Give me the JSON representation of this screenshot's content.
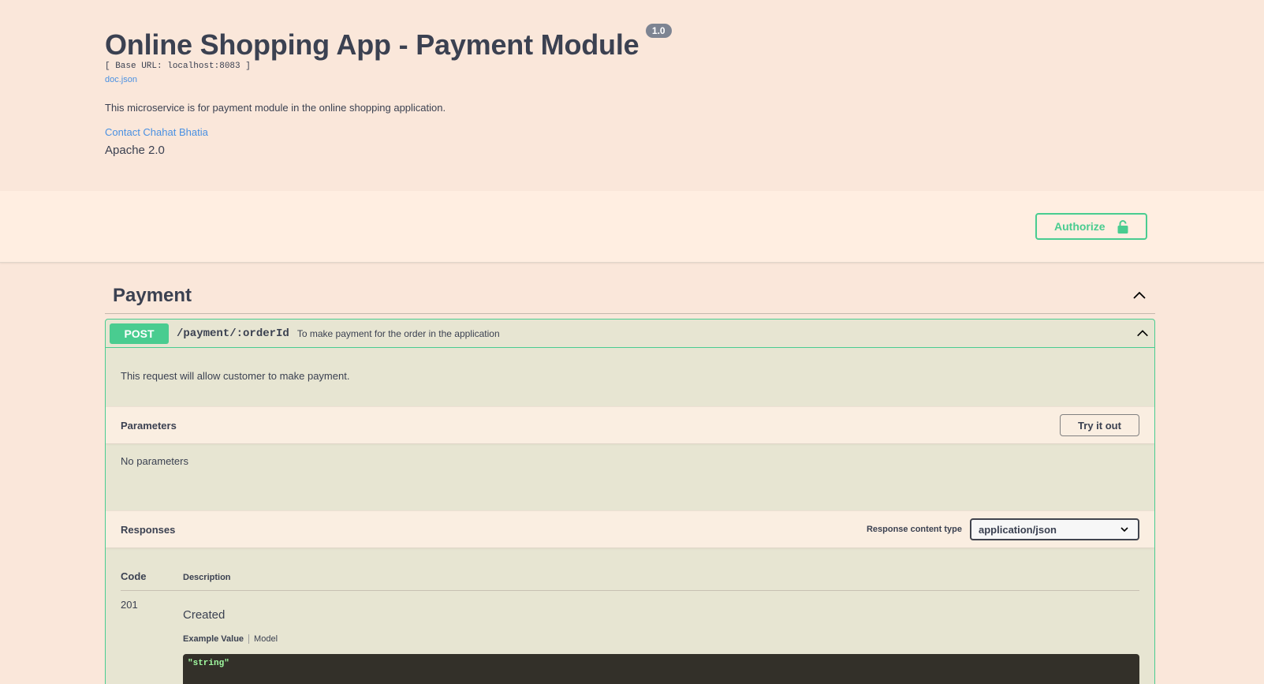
{
  "info": {
    "title": "Online Shopping App - Payment Module",
    "version": "1.0",
    "base_url": "[ Base URL: localhost:8083 ]",
    "doc_link": "doc.json",
    "description": "This microservice is for payment module in the online shopping application.",
    "contact": "Contact Chahat Bhatia",
    "license": "Apache 2.0"
  },
  "auth": {
    "button_label": "Authorize",
    "icon": "lock-icon"
  },
  "tag": {
    "name": "Payment",
    "icon": "chevron-up-icon"
  },
  "operation": {
    "method": "POST",
    "path": "/payment/:orderId",
    "summary": "To make payment for the order in the application",
    "description": "This request will allow customer to make payment.",
    "parameters_title": "Parameters",
    "try_label": "Try it out",
    "no_params": "No parameters",
    "responses_title": "Responses",
    "response_content_type_label": "Response content type",
    "response_content_type": "application/json",
    "responses_columns": {
      "code": "Code",
      "description": "Description"
    },
    "responses": [
      {
        "code": "201",
        "description": "Created",
        "tab_example": "Example Value",
        "tab_model": "Model",
        "example": "\"string\""
      }
    ]
  },
  "colors": {
    "post": "#49cc90",
    "background": "#fae7da",
    "link": "#4990e2"
  }
}
